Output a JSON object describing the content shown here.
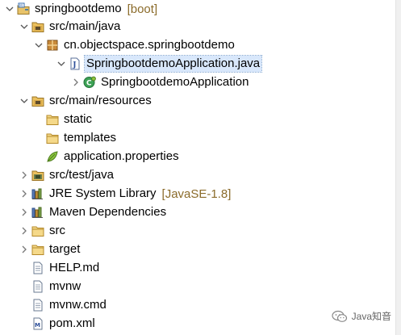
{
  "tree": {
    "rows": [
      {
        "name": "tree-project-springbootdemo",
        "label": "springbootdemo",
        "decoration": "[boot]",
        "icon": "project-icon",
        "arrow": "expanded"
      },
      {
        "name": "tree-source-folder-src-main-java",
        "label": "src/main/java",
        "icon": "source-folder-icon",
        "arrow": "expanded"
      },
      {
        "name": "tree-package-springbootdemo",
        "label": "cn.objectspace.springbootdemo",
        "icon": "package-icon",
        "arrow": "expanded"
      },
      {
        "name": "tree-file-application-java",
        "label": "SpringbootdemoApplication.java",
        "icon": "java-file-icon",
        "arrow": "expanded",
        "selected": true
      },
      {
        "name": "tree-class-springbootdemoapplication",
        "label": "SpringbootdemoApplication",
        "icon": "spring-class-icon",
        "arrow": "collapsed"
      },
      {
        "name": "tree-source-folder-src-main-resources",
        "label": "src/main/resources",
        "icon": "source-folder-icon",
        "arrow": "expanded"
      },
      {
        "name": "tree-folder-static",
        "label": "static",
        "icon": "folder-icon",
        "arrow": "none"
      },
      {
        "name": "tree-folder-templates",
        "label": "templates",
        "icon": "folder-icon",
        "arrow": "none"
      },
      {
        "name": "tree-file-application-properties",
        "label": "application.properties",
        "icon": "properties-file-icon",
        "arrow": "none"
      },
      {
        "name": "tree-source-folder-src-test-java",
        "label": "src/test/java",
        "icon": "test-source-folder-icon",
        "arrow": "collapsed"
      },
      {
        "name": "tree-library-jre",
        "label": "JRE System Library",
        "decoration": "[JavaSE-1.8]",
        "icon": "library-icon",
        "arrow": "collapsed"
      },
      {
        "name": "tree-library-maven",
        "label": "Maven Dependencies",
        "icon": "library-icon",
        "arrow": "collapsed"
      },
      {
        "name": "tree-folder-src",
        "label": "src",
        "icon": "folder-icon",
        "arrow": "collapsed"
      },
      {
        "name": "tree-folder-target",
        "label": "target",
        "icon": "folder-icon",
        "arrow": "collapsed"
      },
      {
        "name": "tree-file-help-md",
        "label": "HELP.md",
        "icon": "file-icon",
        "arrow": "none"
      },
      {
        "name": "tree-file-mvnw",
        "label": "mvnw",
        "icon": "file-icon",
        "arrow": "none"
      },
      {
        "name": "tree-file-mvnw-cmd",
        "label": "mvnw.cmd",
        "icon": "file-icon",
        "arrow": "none"
      },
      {
        "name": "tree-file-pom-xml",
        "label": "pom.xml",
        "icon": "xml-file-icon",
        "arrow": "none"
      }
    ]
  },
  "watermark": {
    "text": "Java知音",
    "icon": "wechat-icon"
  }
}
